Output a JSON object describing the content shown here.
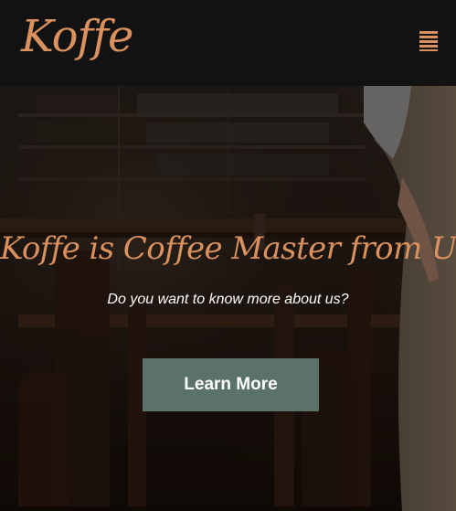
{
  "navbar": {
    "brand": "Koffe",
    "menu_icon": "hamburger-menu-icon"
  },
  "hero": {
    "title": "Koffe is Coffee Master from UK",
    "subtitle": "Do you want to know more about us?",
    "cta_label": "Learn More"
  },
  "colors": {
    "navbar_background": "#121212",
    "accent": "#d9915f",
    "button": "#5b7268",
    "text_light": "#ffffff"
  }
}
